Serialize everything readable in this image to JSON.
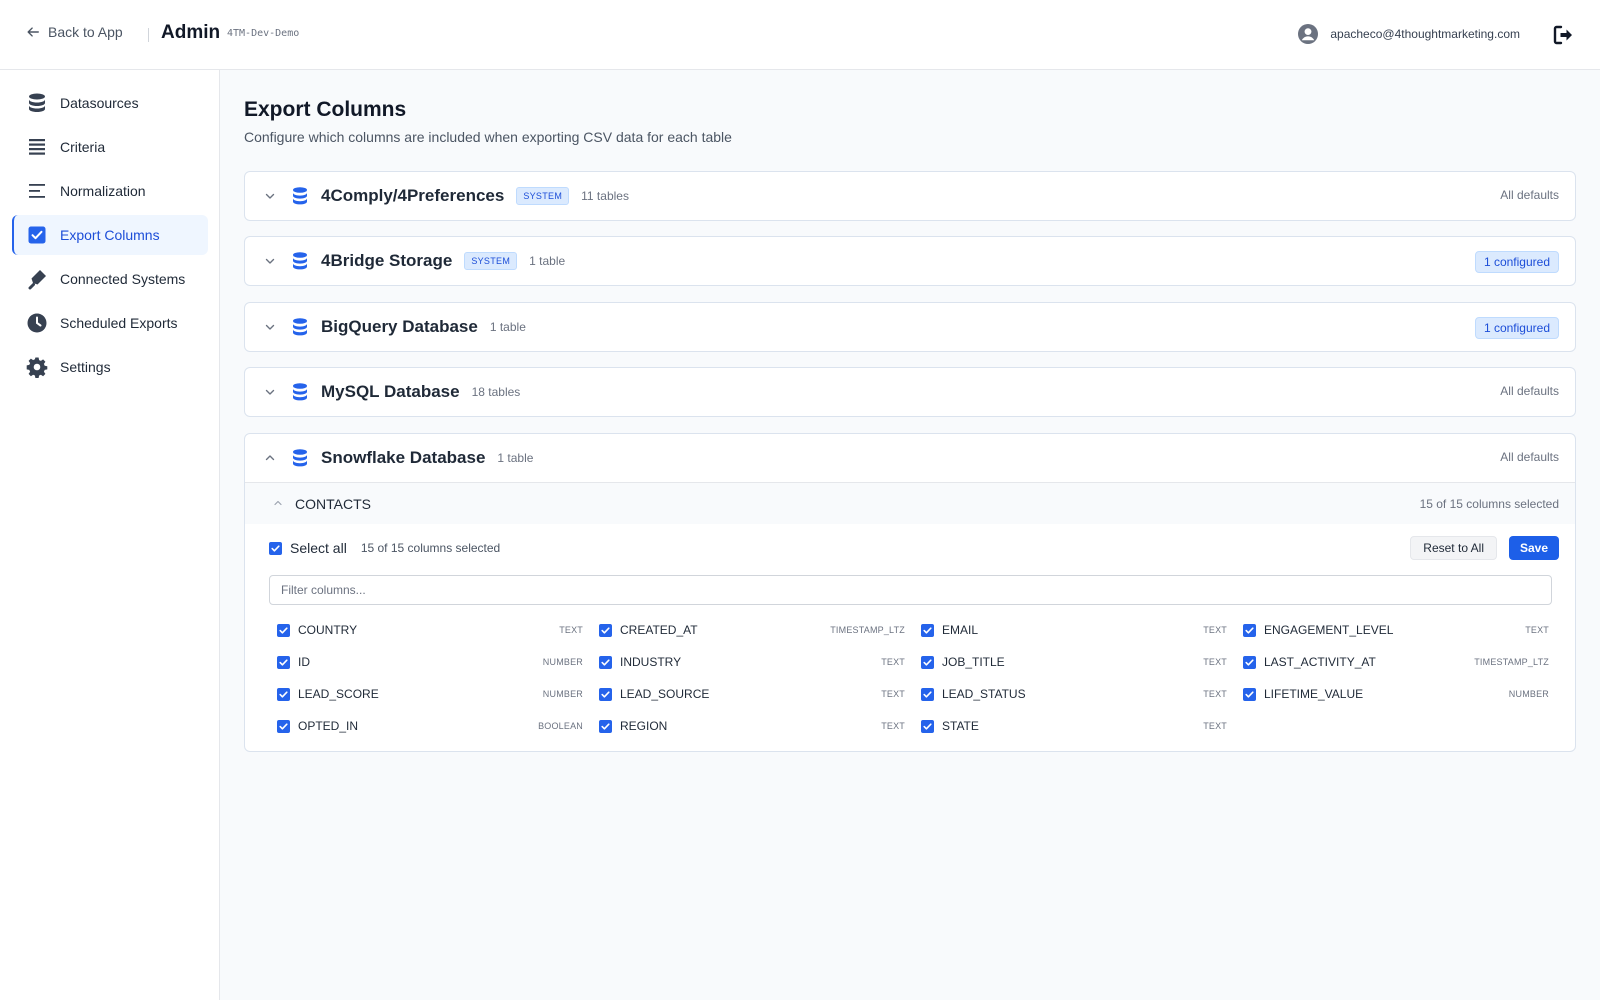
{
  "header": {
    "back_label": "Back to App",
    "title": "Admin",
    "env": "4TM-Dev-Demo",
    "user_email": "apacheco@4thoughtmarketing.com"
  },
  "sidebar": {
    "items": [
      {
        "label": "Datasources",
        "icon": "database-icon"
      },
      {
        "label": "Criteria",
        "icon": "list-icon"
      },
      {
        "label": "Normalization",
        "icon": "lines-icon"
      },
      {
        "label": "Export Columns",
        "icon": "checkbox-icon",
        "active": true
      },
      {
        "label": "Connected Systems",
        "icon": "plug-icon"
      },
      {
        "label": "Scheduled Exports",
        "icon": "clock-icon"
      },
      {
        "label": "Settings",
        "icon": "gear-icon"
      }
    ]
  },
  "page": {
    "title": "Export Columns",
    "subtitle": "Configure which columns are included when exporting CSV data for each table"
  },
  "datasources": [
    {
      "name": "4Comply/4Preferences",
      "badge": "SYSTEM",
      "count": "11 tables",
      "status": "All defaults"
    },
    {
      "name": "4Bridge Storage",
      "badge": "SYSTEM",
      "count": "1 table",
      "status": "1 configured"
    },
    {
      "name": "BigQuery Database",
      "count": "1 table",
      "status": "1 configured"
    },
    {
      "name": "MySQL Database",
      "count": "18 tables",
      "status": "All defaults"
    },
    {
      "name": "Snowflake Database",
      "count": "1 table",
      "status": "All defaults"
    }
  ],
  "table": {
    "name": "CONTACTS",
    "selected_summary": "15 of 15 columns selected",
    "select_all_label": "Select all",
    "select_count": "15 of 15 columns selected",
    "reset_label": "Reset to All",
    "save_label": "Save",
    "filter_placeholder": "Filter columns...",
    "columns": [
      {
        "name": "COUNTRY",
        "type": "TEXT"
      },
      {
        "name": "CREATED_AT",
        "type": "TIMESTAMP_LTZ"
      },
      {
        "name": "EMAIL",
        "type": "TEXT"
      },
      {
        "name": "ENGAGEMENT_LEVEL",
        "type": "TEXT"
      },
      {
        "name": "ID",
        "type": "NUMBER"
      },
      {
        "name": "INDUSTRY",
        "type": "TEXT"
      },
      {
        "name": "JOB_TITLE",
        "type": "TEXT"
      },
      {
        "name": "LAST_ACTIVITY_AT",
        "type": "TIMESTAMP_LTZ"
      },
      {
        "name": "LEAD_SCORE",
        "type": "NUMBER"
      },
      {
        "name": "LEAD_SOURCE",
        "type": "TEXT"
      },
      {
        "name": "LEAD_STATUS",
        "type": "TEXT"
      },
      {
        "name": "LIFETIME_VALUE",
        "type": "NUMBER"
      },
      {
        "name": "OPTED_IN",
        "type": "BOOLEAN"
      },
      {
        "name": "REGION",
        "type": "TEXT"
      },
      {
        "name": "STATE",
        "type": "TEXT"
      }
    ]
  },
  "colors": {
    "accent": "#2563eb",
    "badge_bg": "#dbeafe",
    "badge_text": "#1d4ed8"
  }
}
